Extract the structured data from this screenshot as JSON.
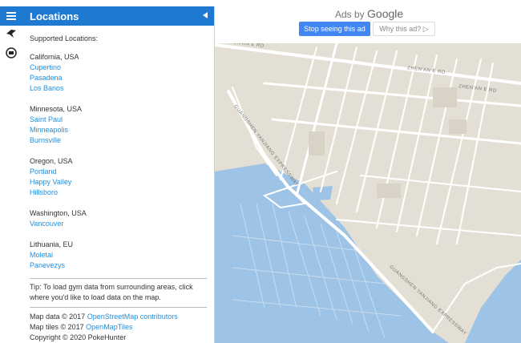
{
  "panel": {
    "title": "Locations",
    "heading": "Supported Locations:",
    "groups": [
      {
        "region": "California, USA",
        "cities": [
          "Cupertino",
          "Pasadena",
          "Los Banos"
        ]
      },
      {
        "region": "Minnesota, USA",
        "cities": [
          "Saint Paul",
          "Minneapolis",
          "Burnsville"
        ]
      },
      {
        "region": "Oregon, USA",
        "cities": [
          "Portland",
          "Happy Valley",
          "Hillsboro"
        ]
      },
      {
        "region": "Washington, USA",
        "cities": [
          "Vancouver"
        ]
      },
      {
        "region": "Lithuania, EU",
        "cities": [
          "Moletai",
          "Panevezys"
        ]
      }
    ],
    "tip": "Tip: To load gym data from surrounding areas, click where you'd like to load data on the map.",
    "credits": {
      "map_data_prefix": "Map data © 2017 ",
      "map_data_link": "OpenStreetMap contributors",
      "map_tiles_prefix": "Map tiles © 2017 ",
      "map_tiles_link": "OpenMapTiles",
      "copyright": "Copyright © 2020 PokeHunter"
    }
  },
  "ad": {
    "ads_by": "Ads by ",
    "google": "Google",
    "stop_label": "Stop seeing this ad",
    "why_label": "Why this ad? ▷"
  },
  "map": {
    "labels": {
      "zhen_an_top": "ZHEN'AN E RD",
      "zhen_an_mid": "ZHEN'AN E RD",
      "zhen_an_right": "ZHEN'AN E RD",
      "expressway_left": "GUANGSHEN YANJIANG EXPRESSWAY",
      "expressway_right": "GUANGSHEN YANJIANG EXPRESSWAY"
    },
    "colors": {
      "land": "#e3dfd4",
      "water": "#9dc3e6",
      "road": "#ffffff"
    }
  },
  "icons": {
    "menu": "menu-icon",
    "collapse": "collapse-arrow-icon",
    "rail1": "pokeball-tool-icon",
    "rail2": "gym-icon"
  }
}
